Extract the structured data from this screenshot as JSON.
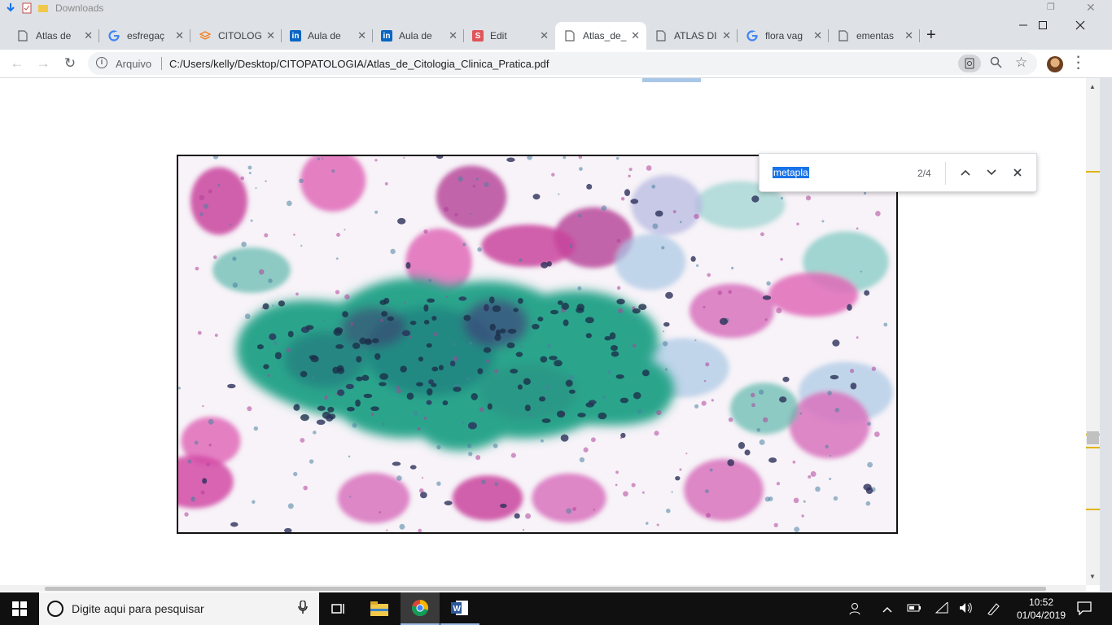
{
  "explorer": {
    "downloads_label": "Downloads"
  },
  "tabs": [
    {
      "title": "Atlas de",
      "favicon": "document-icon",
      "active": false
    },
    {
      "title": "esfregaç",
      "favicon": "google-icon",
      "active": false
    },
    {
      "title": "CITOLOG",
      "favicon": "stack-icon",
      "active": false
    },
    {
      "title": "Aula de",
      "favicon": "linkedin-icon",
      "active": false
    },
    {
      "title": "Aula de",
      "favicon": "linkedin-icon",
      "active": false
    },
    {
      "title": "Edit",
      "favicon": "scribd-icon",
      "active": false
    },
    {
      "title": "Atlas_de_",
      "favicon": "document-icon",
      "active": true
    },
    {
      "title": "ATLAS DI",
      "favicon": "document-icon",
      "active": false
    },
    {
      "title": "flora vag",
      "favicon": "google-icon",
      "active": false
    },
    {
      "title": "ementas",
      "favicon": "document-icon",
      "active": false
    }
  ],
  "toolbar": {
    "site_label": "Arquivo",
    "url": "C:/Users/kelly/Desktop/CITOPATOLOGIA/Atlas_de_Citologia_Clinica_Pratica.pdf"
  },
  "find": {
    "query": "metapla",
    "count": "2/4"
  },
  "taskbar": {
    "search_placeholder": "Digite aqui para pesquisar",
    "time": "10:52",
    "date": "01/04/2019"
  },
  "colors": {
    "tabstrip": "#dee1e6",
    "find_highlight": "#1a73e8",
    "scroll_marker": "#e0b400",
    "taskbar": "#101010",
    "stain_cyan": "#2fa58a",
    "stain_pink": "#d0459f"
  }
}
